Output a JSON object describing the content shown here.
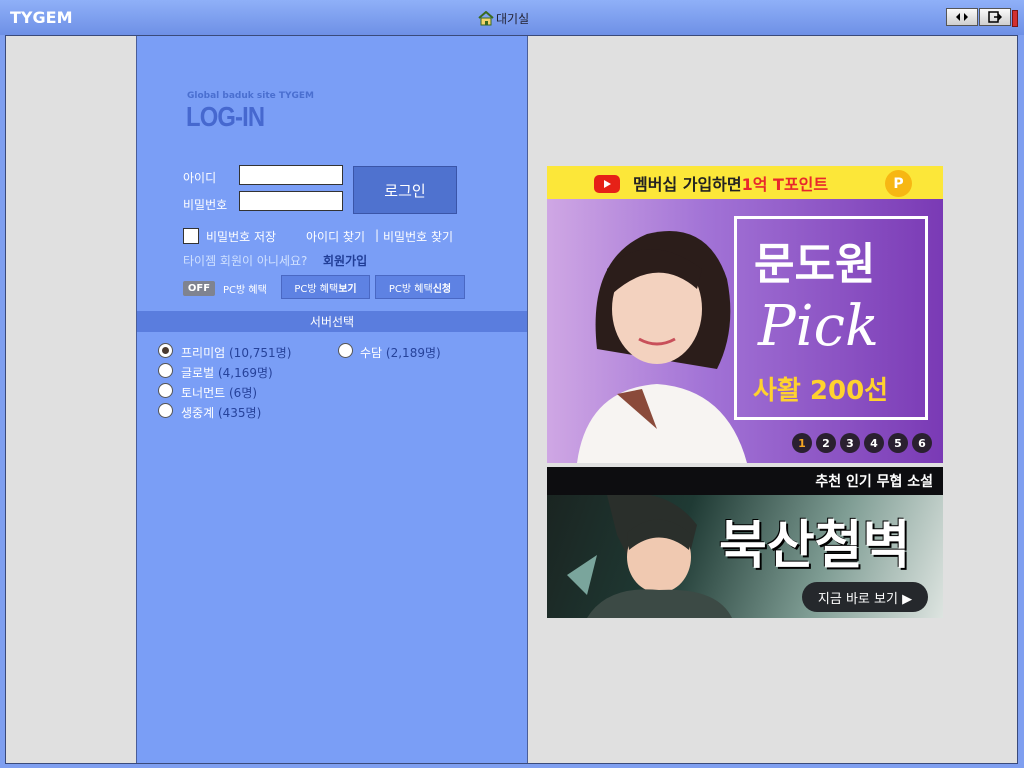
{
  "titlebar": {
    "brand": "TYGEM",
    "title": "대기실",
    "home_icon": "home-icon",
    "btn_arrows_icon": "left-right-arrows-icon",
    "btn_exit_icon": "exit-icon"
  },
  "login": {
    "subtitle": "Global baduk site TYGEM",
    "title": "LOG-IN",
    "id_label": "아이디",
    "pw_label": "비밀번호",
    "id_value": "",
    "pw_value": "",
    "login_button": "로그인",
    "save_pw_label": "비밀번호 저장",
    "find_id": "아이디 찾기",
    "separator": "|",
    "find_pw": "비밀번호 찾기",
    "not_member": "타이젬 회원이 아니세요?",
    "signup": "회원가입",
    "off_badge": "OFF",
    "pc_benefit": "PC방 혜택",
    "pc_view_prefix": "PC방 혜택 ",
    "pc_view_bold": "보기",
    "pc_apply_prefix": "PC방 혜택 ",
    "pc_apply_bold": "신청"
  },
  "servers": {
    "header": "서버선택",
    "items": [
      {
        "name": "프리미엄",
        "count": "(10,751명)",
        "selected": true
      },
      {
        "name": "수담",
        "count": "(2,189명)",
        "selected": false
      },
      {
        "name": "글로벌",
        "count": "(4,169명)",
        "selected": false
      },
      {
        "name": "토너먼트",
        "count": "(6명)",
        "selected": false
      },
      {
        "name": "생중계",
        "count": "(435명)",
        "selected": false
      }
    ]
  },
  "ad1": {
    "top_text_a": "멤버십 가입하면 ",
    "top_text_b": "1억 T포인트",
    "coin": "P",
    "name": "문도원",
    "pick": "Pick",
    "sub": "사활 200선",
    "pages": [
      "1",
      "2",
      "3",
      "4",
      "5",
      "6"
    ],
    "active_page": "1",
    "accent": "#e8272c"
  },
  "ad2": {
    "top": "추천 인기 무협 소설",
    "title": "북산철벽",
    "button": "지금 바로 보기 ▶"
  }
}
